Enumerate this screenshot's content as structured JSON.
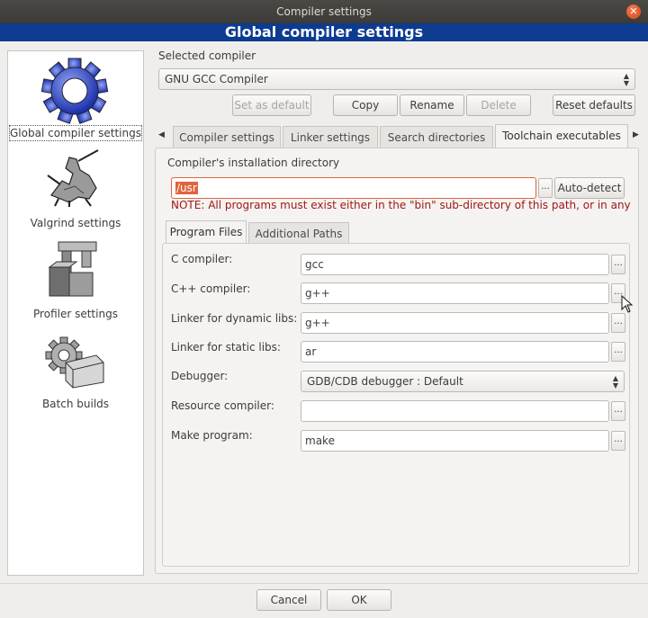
{
  "window": {
    "title": "Compiler settings",
    "close_symbol": "✕"
  },
  "banner": {
    "title": "Global compiler settings"
  },
  "sidebar": {
    "items": [
      {
        "label": "Global compiler settings",
        "icon": "gear-icon"
      },
      {
        "label": "Valgrind settings",
        "icon": "knight-icon"
      },
      {
        "label": "Profiler settings",
        "icon": "caliper-icon"
      },
      {
        "label": "Batch builds",
        "icon": "gear-box-icon"
      }
    ]
  },
  "compiler": {
    "section_label": "Selected compiler",
    "selected": "GNU GCC Compiler",
    "buttons": {
      "set_default": "Set as default",
      "copy": "Copy",
      "rename": "Rename",
      "delete": "Delete",
      "reset": "Reset defaults"
    }
  },
  "tabs": [
    {
      "label": "Compiler settings"
    },
    {
      "label": "Linker settings"
    },
    {
      "label": "Search directories"
    },
    {
      "label": "Toolchain executables"
    }
  ],
  "install_dir": {
    "label": "Compiler's installation directory",
    "value": "/usr",
    "dots": "...",
    "autodetect": "Auto-detect",
    "note": "NOTE: All programs must exist either in the \"bin\" sub-directory of this path, or in any"
  },
  "subtabs": [
    {
      "label": "Program Files"
    },
    {
      "label": "Additional Paths"
    }
  ],
  "programs": [
    {
      "label": "C compiler:",
      "value": "gcc"
    },
    {
      "label": "C++ compiler:",
      "value": "g++"
    },
    {
      "label": "Linker for dynamic libs:",
      "value": "g++"
    },
    {
      "label": "Linker for static libs:",
      "value": "ar"
    },
    {
      "label": "Debugger:",
      "value": "GDB/CDB debugger : Default"
    },
    {
      "label": "Resource compiler:",
      "value": ""
    },
    {
      "label": "Make program:",
      "value": "make"
    }
  ],
  "footer": {
    "cancel": "Cancel",
    "ok": "OK"
  }
}
